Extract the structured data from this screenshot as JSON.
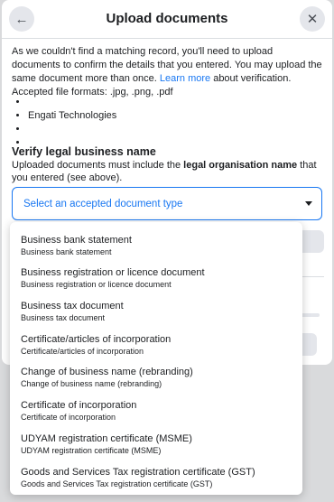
{
  "dialog": {
    "title": "Upload documents",
    "back_glyph": "←",
    "close_glyph": "✕",
    "back_icon": "arrow-left-icon",
    "close_icon": "close-icon"
  },
  "intro": {
    "text_before_link": "As we couldn't find a matching record, you'll need to upload documents to confirm the details that you entered. You may upload the same document more than once. ",
    "link_text": "Learn more",
    "text_after_link": " about verification. Accepted file formats: .jpg, .png, .pdf"
  },
  "entered_details": [
    "",
    "Engati Technologies",
    "",
    ""
  ],
  "verify": {
    "title": "Verify legal business name",
    "desc_before": "Uploaded documents must include the ",
    "desc_bold": "legal organisation name",
    "desc_after": " that you entered (see above)."
  },
  "document_type_select": {
    "placeholder": "Select an accepted document type"
  },
  "document_type_options": [
    {
      "label": "Business bank statement",
      "sub": "Business bank statement"
    },
    {
      "label": "Business registration or licence document",
      "sub": "Business registration or licence document"
    },
    {
      "label": "Business tax document",
      "sub": "Business tax document"
    },
    {
      "label": "Certificate/articles of incorporation",
      "sub": "Certificate/articles of incorporation"
    },
    {
      "label": "Change of business name (rebranding)",
      "sub": "Change of business name (rebranding)"
    },
    {
      "label": "Certificate of incorporation",
      "sub": "Certificate of incorporation"
    },
    {
      "label": "UDYAM registration certificate (MSME)",
      "sub": "UDYAM registration certificate (MSME)"
    },
    {
      "label": "Goods and Services Tax registration certificate (GST)",
      "sub": "Goods and Services Tax registration certificate (GST)"
    }
  ],
  "colors": {
    "accent": "#1877f2",
    "backdrop": "#d9dadc",
    "surface": "#ffffff"
  }
}
